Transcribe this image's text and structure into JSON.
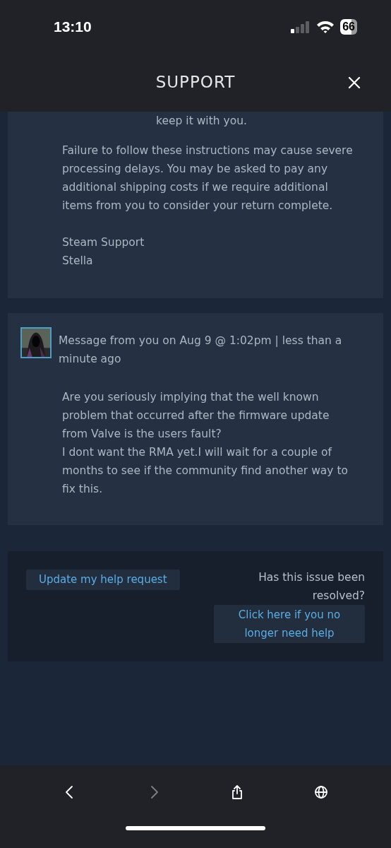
{
  "status_bar": {
    "time": "13:10",
    "battery": "66"
  },
  "header": {
    "title": "SUPPORT"
  },
  "messages": [
    {
      "kind": "staff",
      "paragraphs": [
        "keep it with you.",
        "Failure to follow these instructions may cause severe processing delays. You may be asked to pay any additional shipping costs if we require additional items from you to consider your return complete."
      ],
      "signature": [
        "Steam Support",
        "Stella"
      ]
    },
    {
      "kind": "user",
      "meta": "Message from you on Aug 9 @ 1:02pm | less than a minute ago",
      "lines": [
        "Are you seriously implying that the well known problem that occurred after the firmware update from Valve is the users fault?",
        "I dont want the RMA yet.I will wait for a couple of months to see if the community find another way to fix this."
      ]
    }
  ],
  "actions": {
    "update_button": "Update my help request",
    "question": "Has this issue been resolved?",
    "resolve_button": "Click here if you no longer need help"
  },
  "toolbar": [
    {
      "kind": "back",
      "disabled": false
    },
    {
      "kind": "forward",
      "disabled": true
    },
    {
      "kind": "share",
      "disabled": false
    },
    {
      "kind": "globe",
      "disabled": false
    }
  ]
}
